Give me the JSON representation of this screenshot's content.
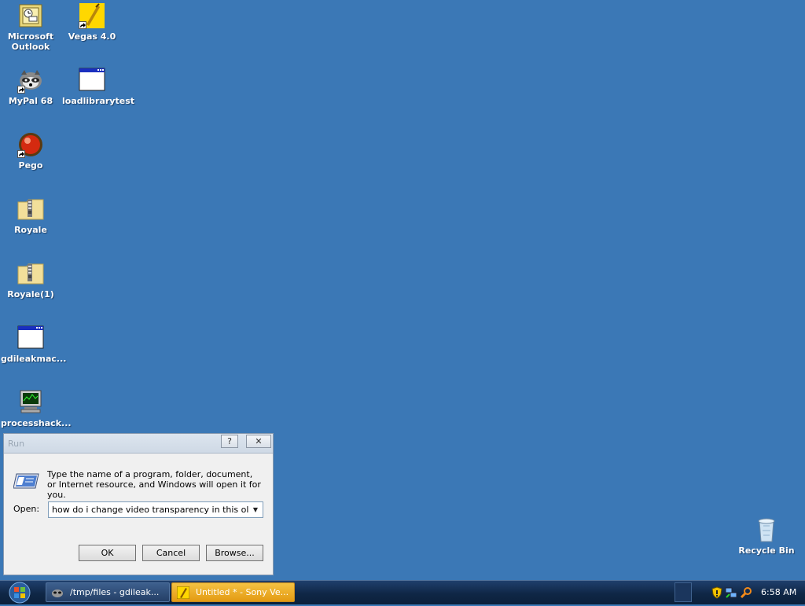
{
  "desktop": {
    "icons": [
      {
        "id": "outlook",
        "label": "Microsoft Outlook",
        "icon": "outlook-icon"
      },
      {
        "id": "vegas",
        "label": "Vegas 4.0",
        "icon": "vegas-icon"
      },
      {
        "id": "mypal",
        "label": "MyPal 68",
        "icon": "raccoon-icon"
      },
      {
        "id": "loadlib",
        "label": "loadlibrarytest",
        "icon": "window-icon"
      },
      {
        "id": "pego",
        "label": "Pego",
        "icon": "red-ball-icon"
      },
      {
        "id": "royale",
        "label": "Royale",
        "icon": "zip-folder-icon"
      },
      {
        "id": "royale1",
        "label": "Royale(1)",
        "icon": "zip-folder-icon"
      },
      {
        "id": "gdileak",
        "label": "gdileakmac...",
        "icon": "window-icon"
      },
      {
        "id": "processhack",
        "label": "processhack...",
        "icon": "monitor-icon"
      },
      {
        "id": "recycle",
        "label": "Recycle Bin",
        "icon": "recycle-bin-icon"
      }
    ]
  },
  "run_dialog": {
    "title": "Run",
    "help_glyph": "?",
    "close_glyph": "✕",
    "description": "Type the name of a program, folder, document, or Internet resource, and Windows will open it for you.",
    "open_label": "Open:",
    "open_value": "how do i change video transparency in this old vega",
    "ok_label": "OK",
    "cancel_label": "Cancel",
    "browse_label": "Browse..."
  },
  "taskbar": {
    "tasks": [
      {
        "label": "/tmp/files - gdileak...",
        "icon": "raccoon-icon"
      },
      {
        "label": "Untitled * - Sony Ve...",
        "icon": "vegas-icon",
        "active": true
      }
    ],
    "clock": "6:58 AM",
    "tray_icons": [
      "shield-icon",
      "network-icon",
      "search-icon"
    ]
  },
  "colors": {
    "desktop": "#3b78b6",
    "taskbar": "#0f2746",
    "active_task": "#e39a12"
  }
}
